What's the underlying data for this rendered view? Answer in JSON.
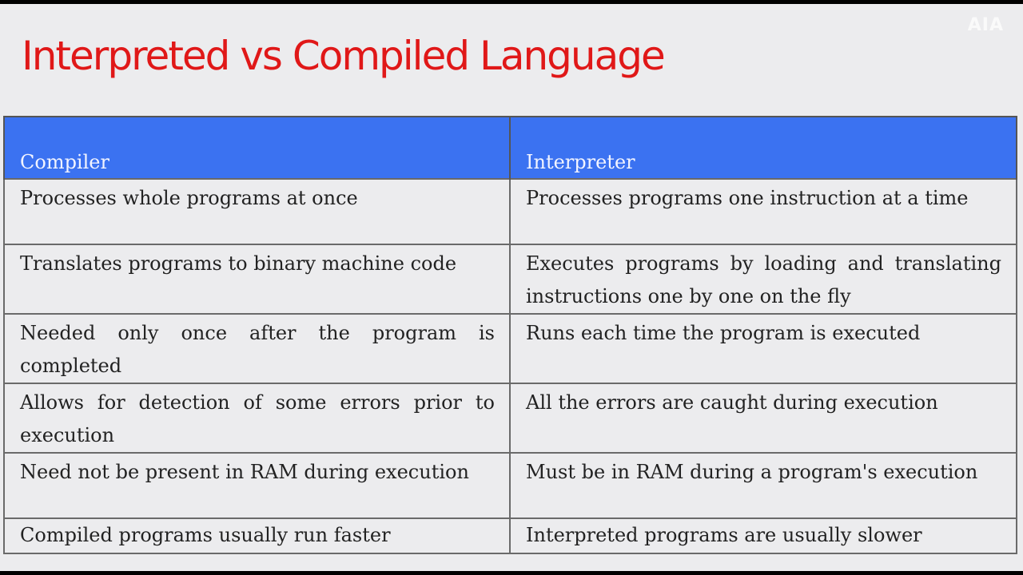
{
  "slide": {
    "title": "Interpreted vs Compiled Language",
    "watermark": "AIA",
    "title_color": "#e01818",
    "header_color": "#3b72f1"
  },
  "table": {
    "headers": [
      "Compiler",
      "Interpreter"
    ],
    "rows": [
      [
        "Processes whole programs at once",
        "Processes programs one instruction at a time"
      ],
      [
        "Translates programs to binary machine code",
        "Executes programs by loading and translating instructions one by one on the fly"
      ],
      [
        "Needed only once after the program is completed",
        "Runs each time the program is executed"
      ],
      [
        "Allows for detection of some errors prior to execution",
        "All the errors are caught during execution"
      ],
      [
        "Need not be present in RAM during execution",
        "Must be in RAM during a program's execution"
      ],
      [
        "Compiled programs usually run faster",
        "Interpreted programs are usually slower"
      ]
    ]
  }
}
